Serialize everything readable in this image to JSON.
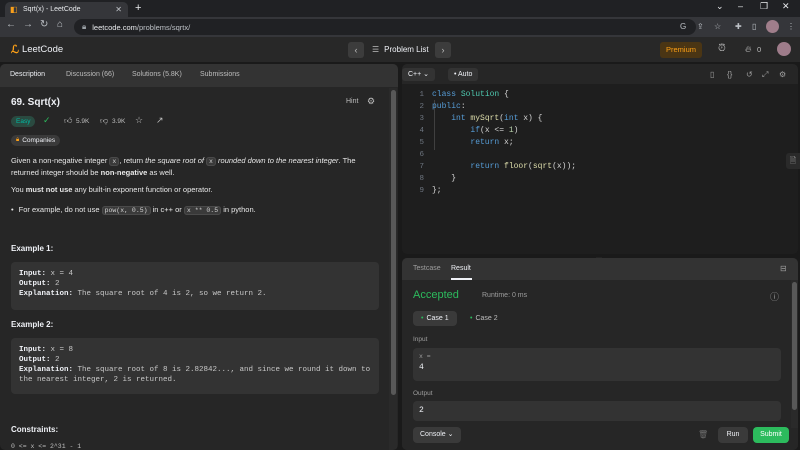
{
  "browser": {
    "tab_title": "Sqrt(x) - LeetCode",
    "url_host": "leetcode.com",
    "url_path": "/problems/sqrtx/"
  },
  "header": {
    "logo_text": "LeetCode",
    "problem_list": "Problem List",
    "premium": "Premium",
    "points": "0"
  },
  "left": {
    "tabs": [
      "Description",
      "Discussion (66)",
      "Solutions (5.8K)",
      "Submissions"
    ],
    "title": "69. Sqrt(x)",
    "hint": "Hint",
    "difficulty": "Easy",
    "likes": "5.9K",
    "dislikes": "3.9K",
    "companies": "Companies",
    "desc_1": "Given a non-negative integer ",
    "desc_x": "x",
    "desc_2": ", return ",
    "desc_3": "the square root of ",
    "desc_4": "rounded down to the nearest integer",
    "desc_5": ". The returned integer should be ",
    "desc_6": "non-negative",
    "desc_7": " as well.",
    "rule_1": "You ",
    "rule_2": "must not use",
    "rule_3": " any built-in exponent function or operator.",
    "bullet_1": "For example, do not use ",
    "bullet_code1": "pow(x, 0.5)",
    "bullet_2": " in c++ or ",
    "bullet_code2": "x ** 0.5",
    "bullet_3": " in python.",
    "example1": {
      "heading": "Example 1:",
      "input_label": "Input:",
      "input": " x = 4",
      "output_label": "Output:",
      "output": " 2",
      "expl_label": "Explanation:",
      "expl": " The square root of 4 is 2, so we return 2."
    },
    "example2": {
      "heading": "Example 2:",
      "input_label": "Input:",
      "input": " x = 8",
      "output_label": "Output:",
      "output": " 2",
      "expl_label": "Explanation:",
      "expl_line1": " The square root of 8 is 2.82842..., and since we round it down to",
      "expl_line2": "the nearest integer, 2 is returned."
    },
    "constraints": "Constraints:",
    "constraint_partial": "0 <= x <= 2^31 - 1"
  },
  "editor": {
    "language": "C++",
    "mode": "Auto",
    "lines": [
      "1",
      "2",
      "3",
      "4",
      "5",
      "6",
      "7",
      "8",
      "9"
    ]
  },
  "result": {
    "tabs": [
      "Testcase",
      "Result"
    ],
    "status": "Accepted",
    "runtime": "Runtime: 0 ms",
    "case1": "Case 1",
    "case2": "Case 2",
    "input_label": "Input",
    "input_var": "x =",
    "input_val": "4",
    "output_label": "Output",
    "output_val": "2",
    "console": "Console",
    "run": "Run",
    "submit": "Submit"
  },
  "colors": {
    "accepted": "#2cbb5d",
    "easy": "#00b8a3",
    "brand": "#ffa116"
  }
}
